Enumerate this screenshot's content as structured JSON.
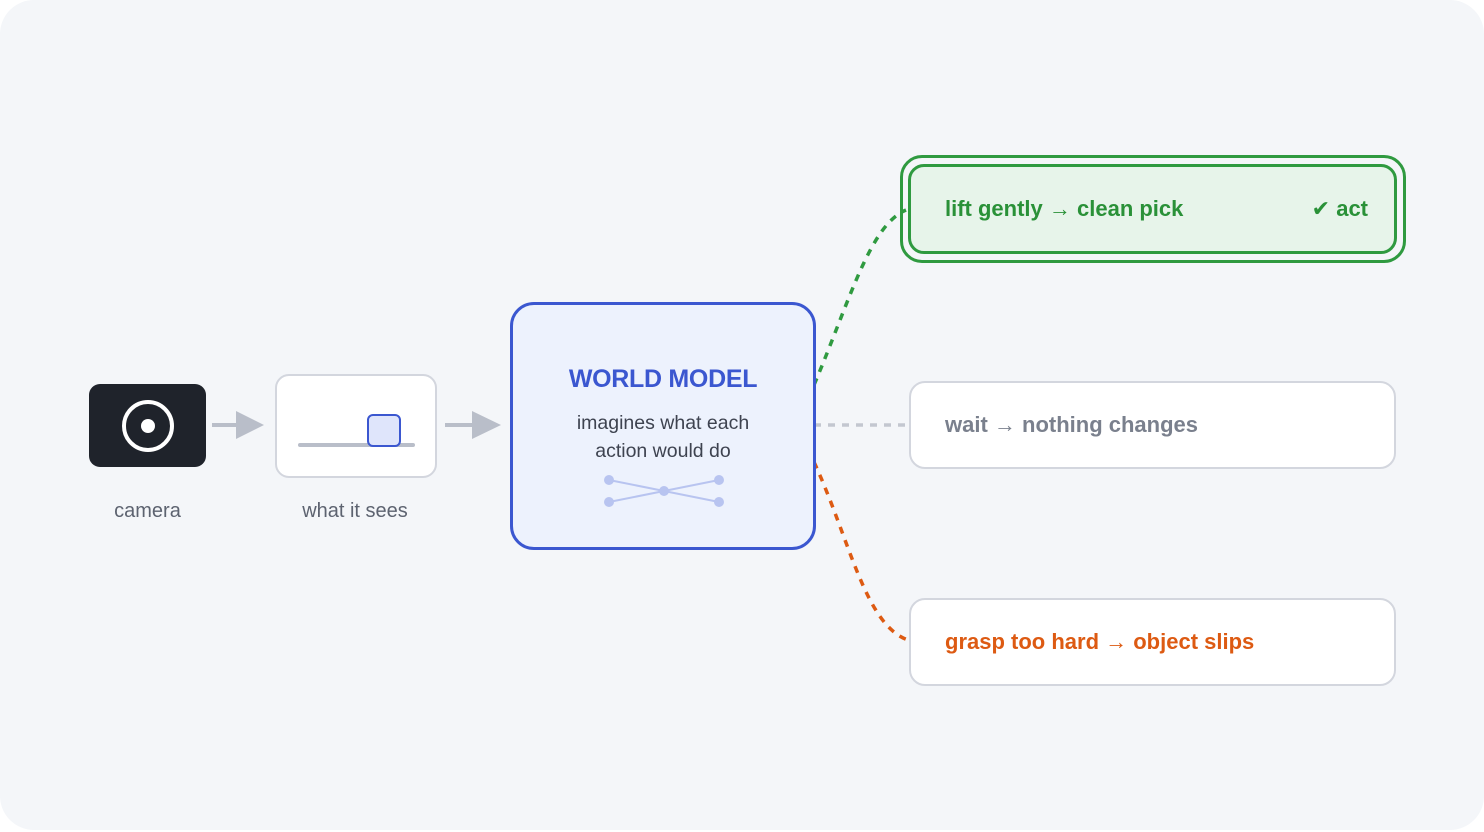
{
  "colors": {
    "background": "#f4f6f9",
    "accent_blue": "#3b57d0",
    "good_green": "#2f9a40",
    "neutral_gray": "#b9bec9",
    "bad_orange": "#dd5a12",
    "camera_dark": "#1f232b"
  },
  "pipeline": {
    "camera": {
      "icon": "camera-lens-icon",
      "caption": "camera"
    },
    "view": {
      "icon": "object-on-surface-icon",
      "caption": "what it sees"
    },
    "world_model": {
      "title": "WORLD MODEL",
      "subtitle_line1": "imagines what each",
      "subtitle_line2": "action would do",
      "icon": "network-icon"
    }
  },
  "options": [
    {
      "label": "lift gently → clean pick",
      "badge": "✔ act",
      "outcome": "good"
    },
    {
      "label": "wait → nothing changes",
      "outcome": "neutral"
    },
    {
      "label": "grasp too hard → object slips",
      "outcome": "bad"
    }
  ]
}
